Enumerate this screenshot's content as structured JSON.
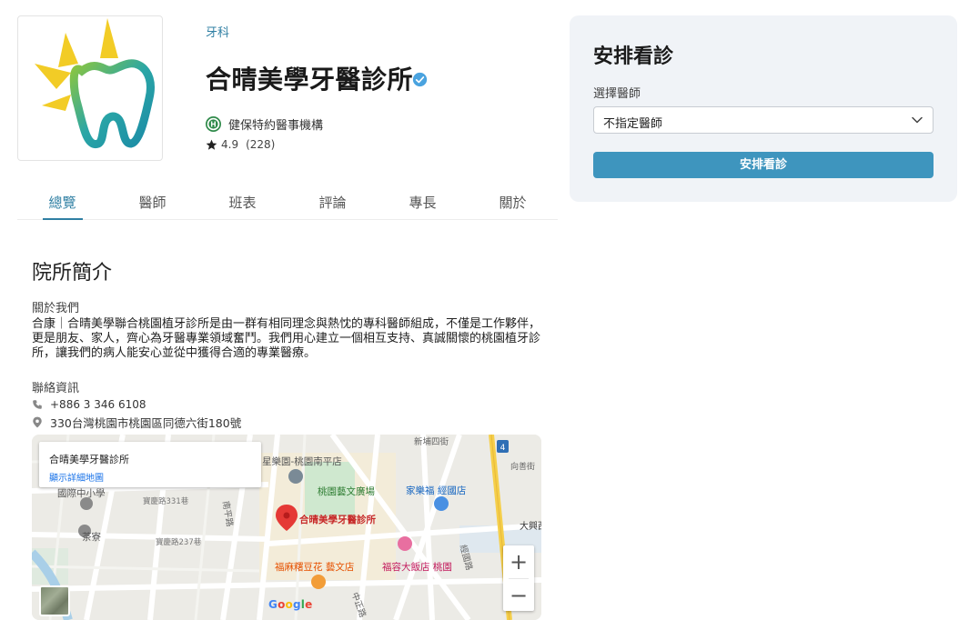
{
  "clinic": {
    "specialty": "牙科",
    "name": "合晴美學牙醫診所",
    "insurance": "健保特約醫事機構",
    "rating": "4.9",
    "reviews": "(228)"
  },
  "tabs": [
    "總覽",
    "醫師",
    "班表",
    "評論",
    "專長",
    "關於"
  ],
  "about": {
    "section_title": "院所簡介",
    "label": "關於我們",
    "text": "合康｜合晴美學聯合桃園植牙診所是由一群有相同理念與熱忱的專科醫師組成，不僅是工作夥伴，更是朋友、家人，齊心為牙醫專業領域奮鬥。我們用心建立一個相互支持、真誠關懷的桃園植牙診所，讓我們的病人能安心並從中獲得合適的專業醫療。"
  },
  "contact": {
    "label": "聯絡資訊",
    "phone": "+886 3 346 6108",
    "address": "330台灣桃園市桃園區同德六街180號"
  },
  "map": {
    "card_title": "合晴美學牙醫診所",
    "card_link": "顯示詳細地圖",
    "pin_label": "合晴美學牙醫診所",
    "labels": {
      "l1": "星樂園-桃園南平店",
      "l2": "桃園藝文廣場",
      "l3": "家樂福 經國店",
      "l4": "國際中小學",
      "l5": "茶寮",
      "l6": "福麻糬豆花 藝文店",
      "l7": "福容大飯店 桃園",
      "l8": "南平路",
      "l9": "大興西",
      "l10": "新埔四街",
      "l11": "寶慶路331巷",
      "l12": "寶慶路237巷",
      "l13": "中正路",
      "l14": "經國路",
      "l15": "向善街"
    },
    "zoom_in": "+",
    "zoom_out": "−",
    "google": "Google"
  },
  "booking": {
    "title": "安排看診",
    "doctor_label": "選擇醫師",
    "doctor_value": "不指定醫師",
    "button": "安排看診"
  },
  "colors": {
    "accent": "#3e95be",
    "link": "#2f7fa3",
    "panel_bg": "#f0f3f7",
    "pin": "#e53935"
  }
}
